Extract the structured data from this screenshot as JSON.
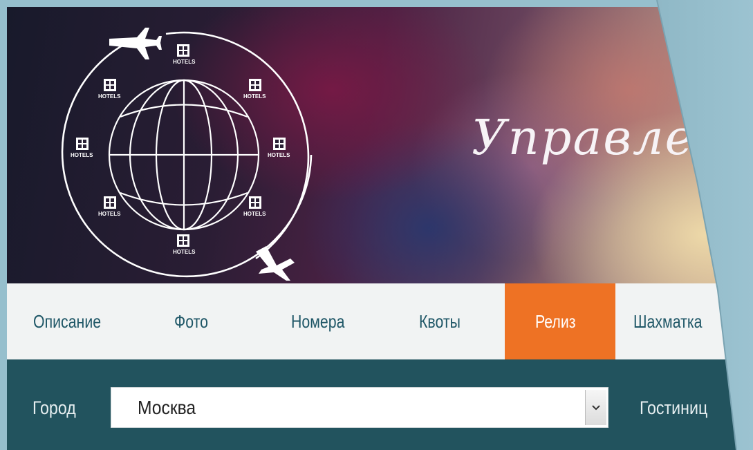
{
  "banner": {
    "title": "Управлен",
    "logo_label": "HOTELS"
  },
  "tabs": [
    {
      "label": "Описание",
      "active": false
    },
    {
      "label": "Фото",
      "active": false
    },
    {
      "label": "Номера",
      "active": false
    },
    {
      "label": "Квоты",
      "active": false
    },
    {
      "label": "Релиз",
      "active": true
    },
    {
      "label": "Шахматка",
      "active": false
    }
  ],
  "filters": {
    "city_label": "Город",
    "city_value": "Москва",
    "hotel_label": "Гостиниц"
  },
  "colors": {
    "background": "#96bfcd",
    "tab_bar": "#f1f3f3",
    "tab_text": "#1e5666",
    "active_tab": "#ee7224",
    "filter_bar": "#22535e"
  },
  "icons": {
    "select_arrow": "chevron-down-icon",
    "logo": "globe-hotels-logo",
    "plane": "airplane-icon",
    "building": "hotel-building-icon"
  }
}
